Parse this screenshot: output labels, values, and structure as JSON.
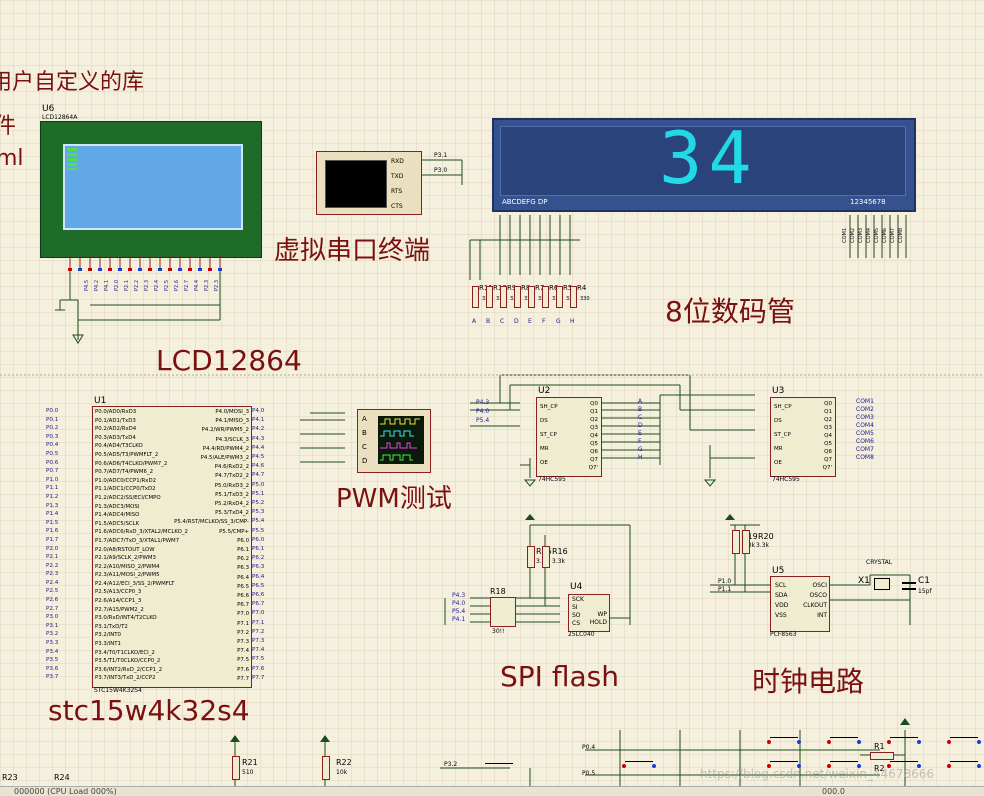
{
  "labels": {
    "user_lib": "用户自定义的库",
    "side1": "件",
    "side2": "ml",
    "serial": "虚拟串口终端",
    "seg": "8位数码管",
    "lcd": "LCD12864",
    "pwm": "PWM测试",
    "mcu": "stc15w4k32s4",
    "spi": "SPI flash",
    "clock": "时钟电路"
  },
  "components": {
    "u6_ref": "U6",
    "u6_part": "LCD12864A",
    "u1_ref": "U1",
    "u1_part": "STC15W4K32S4",
    "u2_ref": "U2",
    "u2_part": "74HC595",
    "u3_ref": "U3",
    "u3_part": "74HC595",
    "u4_ref": "U4",
    "u4_part": "25LC040",
    "u5_ref": "U5",
    "u5_part": "PCF8563",
    "x1_ref": "X1",
    "x1_part": "CRYSTAL",
    "c1_ref": "C1",
    "c1_val": "15pf",
    "r18_ref": "R18",
    "r18_val": "30!!",
    "r15_ref": "R15",
    "r16_ref": "R16",
    "r15_val": "3.3k",
    "r16_val": "3.3k",
    "r19_ref": "R19",
    "r20_ref": "R20",
    "r19_val": "3.3k",
    "r20_val": "3.3k",
    "r21_ref": "R21",
    "r21_val": "510",
    "r22_ref": "R22",
    "r22_val": "10k",
    "r1_ref": "R1",
    "r2_ref": "R2",
    "r24_ref": "R24",
    "r23_ref": "R23",
    "seg_r_refs": [
      "R11",
      "R10",
      "R9",
      "R8",
      "R7",
      "R6",
      "R5",
      "R4"
    ],
    "seg_r_val": "330"
  },
  "display": {
    "digits": "34",
    "seg_left_label": "ABCDEFG DP",
    "seg_right_label": "12345678",
    "com_labels": [
      "COM1",
      "COM2",
      "COM3",
      "COM4",
      "COM5",
      "COM6",
      "COM7",
      "COM8"
    ]
  },
  "serial_pins": [
    "RXD",
    "TXD",
    "RTS",
    "CTS"
  ],
  "serial_nets": [
    "P3.1",
    "P3.0"
  ],
  "lcd_nets": [
    "P4.5",
    "P4.2",
    "P4.1",
    "P2.0",
    "P2.1",
    "P2.2",
    "P2.3",
    "P2.4",
    "P2.5",
    "P2.6",
    "P2.7",
    "P4.4",
    "P2.3",
    "P2.3"
  ],
  "u1": {
    "left_nets": [
      "P0.0",
      "P0.1",
      "P0.2",
      "P0.3",
      "P0.4",
      "P0.5",
      "P0.6",
      "P0.7",
      "P1.0",
      "P1.1",
      "P1.2",
      "P1.3",
      "P1.4",
      "P1.5",
      "P1.6",
      "P1.7",
      "P2.0",
      "P2.1",
      "P2.2",
      "P2.3",
      "P2.4",
      "P2.5",
      "P2.6",
      "P2.7",
      "P3.0",
      "P3.1",
      "P3.2",
      "P3.3",
      "P3.4",
      "P3.5",
      "P3.6",
      "P3.7"
    ],
    "left_pins": [
      "P0.0/AD0/RxD3",
      "P0.1/AD1/TxD3",
      "P0.2/AD2/RxD4",
      "P0.3/AD3/TxD4",
      "P0.4/AD4/T3CLKO",
      "P0.5/AD5/T3/PWMFLT_2",
      "P0.6/AD6/T4CLKO/PWM7_2",
      "P0.7/AD7/T4/PWM6_2",
      "P1.0/ADC0/CCP1/RxD2",
      "P1.1/ADC1/CCP0/TxD2",
      "P1.2/ADC2/SS/ECI/CMPO",
      "P1.3/ADC3/MOSI",
      "P1.4/ADC4/MISO",
      "P1.5/ADC5/SCLK",
      "P1.6/ADC6/RxD_3/XTAL2/MCLKO_2",
      "P1.7/ADC7/TxD_3/XTAL1/PWM7",
      "P2.0/A8/RSTOUT_LOW",
      "P2.1/A9/SCLK_2/PWM3",
      "P2.2/A10/MISO_2/PWM4",
      "P2.3/A11/MOSI_2/PWM5",
      "P2.4/A12/ECI_3/SS_2/PWMFLT",
      "P2.5/A13/CCP0_3",
      "P2.6/A14/CCP1_3",
      "P2.7/A15/PWM2_2",
      "P3.0/RxD/INT4/T2CLKO",
      "P3.1/TxD/T2",
      "P3.2/INT0",
      "P3.3/INT1",
      "P3.4/T0/T1CLKO/ECI_2",
      "P3.5/T1/T0CLKO/CCP0_2",
      "P3.6/INT2/RxD_2/CCP1_2",
      "P3.7/INT3/TxD_2/CCP2"
    ],
    "right_nets": [
      "P4.0",
      "P4.1",
      "P4.2",
      "P4.3",
      "P4.4",
      "P4.5",
      "P4.6",
      "P4.7",
      "P5.0",
      "P5.1",
      "P5.2",
      "P5.3",
      "P5.4",
      "P5.5",
      "P6.0",
      "P6.1",
      "P6.2",
      "P6.3",
      "P6.4",
      "P6.5",
      "P6.6",
      "P6.7",
      "P7.0",
      "P7.1",
      "P7.2",
      "P7.3",
      "P7.4",
      "P7.5",
      "P7.6",
      "P7.7"
    ],
    "right_pins": [
      "P4.0/MOSI_3",
      "P4.1/MISO_3",
      "P4.2/WR/PWM5_2",
      "P4.3/SCLK_3",
      "P4.4/RD/PWM4_2",
      "P4.5/ALE/PWM3_2",
      "P4.6/RxD2_2",
      "P4.7/TxD2_2",
      "P5.0/RxD3_2",
      "P5.1/TxD3_2",
      "P5.2/RxD4_2",
      "P5.3/TxD4_2",
      "P5.4/RST/MCLKO/SS_3/CMP-",
      "P5.5/CMP+",
      "P6.0",
      "P6.1",
      "P6.2",
      "P6.3",
      "P6.4",
      "P6.5",
      "P6.6",
      "P6.7",
      "P7.0",
      "P7.1",
      "P7.2",
      "P7.3",
      "P7.4",
      "P7.5",
      "P7.6",
      "P7.7"
    ]
  },
  "u2": {
    "in_nets": [
      "P4.3",
      "P4.0",
      "P5.4"
    ],
    "left_pins": [
      "SH_CP",
      "DS",
      "ST_CP",
      "MR",
      "OE"
    ],
    "right_pins": [
      "Q0",
      "Q1",
      "Q2",
      "Q3",
      "Q4",
      "Q5",
      "Q6",
      "Q7",
      "Q7'"
    ],
    "out_nets": [
      "A",
      "B",
      "C",
      "D",
      "E",
      "F",
      "G",
      "H"
    ]
  },
  "u3": {
    "left_pins": [
      "SH_CP",
      "DS",
      "ST_CP",
      "MR",
      "OE"
    ],
    "right_pins": [
      "Q0",
      "Q1",
      "Q2",
      "Q3",
      "Q4",
      "Q5",
      "Q6",
      "Q7",
      "Q7'"
    ],
    "out_nets": [
      "COM1",
      "COM2",
      "COM3",
      "COM4",
      "COM5",
      "COM6",
      "COM7",
      "COM8"
    ]
  },
  "scope_pins": [
    "A",
    "B",
    "C",
    "D"
  ],
  "u4": {
    "nets": [
      "P4.3",
      "P4.0",
      "P5.4",
      "P4.1"
    ],
    "pins": [
      "SCK",
      "SI",
      "SO",
      "CS"
    ],
    "right_pins": [
      "WP",
      "HOLD"
    ]
  },
  "u5": {
    "nets": [
      "P1.0",
      "P1.1"
    ],
    "left_pins": [
      "SCL",
      "SDA",
      "VDD",
      "VSS"
    ],
    "right_pins": [
      "OSCI",
      "OSCO",
      "CLKOUT",
      "INT"
    ]
  },
  "keys": {
    "nets": [
      "P3.2",
      "P0.4",
      "P0.5"
    ]
  },
  "watermark": "https://blog.csdn.net/weixin_44678666",
  "status_left": "000000 (CPU Load 000%)",
  "status_right": "000.0"
}
